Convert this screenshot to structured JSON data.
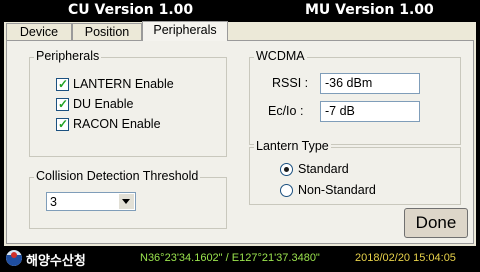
{
  "title": {
    "left": "CU Version 1.00",
    "right": "MU Version 1.00"
  },
  "tabs": [
    {
      "label": "Device",
      "active": false
    },
    {
      "label": "Position",
      "active": false
    },
    {
      "label": "Peripherals",
      "active": true
    }
  ],
  "peripherals": {
    "title": "Peripherals",
    "items": [
      {
        "label": "LANTERN Enable",
        "checked": true
      },
      {
        "label": "DU Enable",
        "checked": true
      },
      {
        "label": "RACON Enable",
        "checked": true
      }
    ]
  },
  "wcdma": {
    "title": "WCDMA",
    "rssi_label": "RSSI :",
    "rssi_value": "-36 dBm",
    "ecio_label": "Ec/Io :",
    "ecio_value": "-7 dB"
  },
  "lantern_type": {
    "title": "Lantern Type",
    "options": [
      {
        "label": "Standard",
        "selected": true
      },
      {
        "label": "Non-Standard",
        "selected": false
      }
    ]
  },
  "collision": {
    "title": "Collision Detection Threshold",
    "value": "3"
  },
  "done_label": "Done",
  "status": {
    "org_name": "해양수산청",
    "coords": "N36°23'34.1602\" / E127°21'37.3480\"",
    "datetime": "2018/02/20 15:04:05"
  },
  "colors": {
    "coords_text": "#9be44e",
    "datetime_text": "#e8d24a",
    "checkmark": "#21a121"
  },
  "icons": {
    "checkbox_mark": "✓",
    "dropdown": "chevron-down-icon",
    "logo": "org-logo-icon"
  }
}
